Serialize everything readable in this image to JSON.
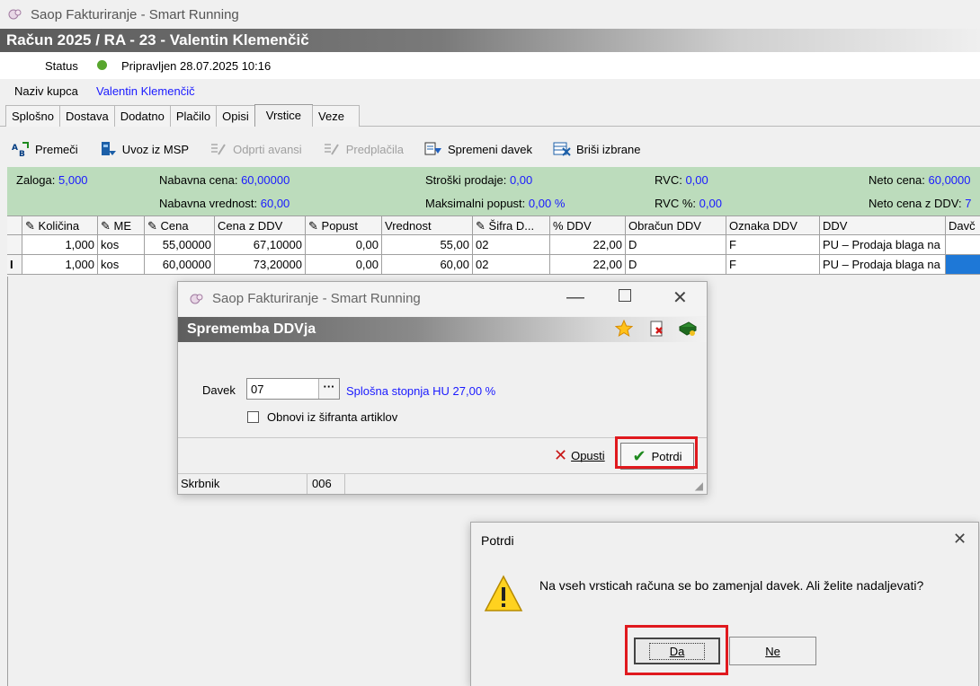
{
  "app": {
    "title": "Saop Fakturiranje - Smart Running"
  },
  "document": {
    "header": "Račun  2025 / RA - 23 - Valentin Klemenčič"
  },
  "status": {
    "label": "Status",
    "text": "Pripravljen 28.07.2025 10:16",
    "color": "#58a62e"
  },
  "customer": {
    "label": "Naziv kupca",
    "value": "Valentin Klemenčič"
  },
  "tabs": [
    {
      "label": "Splošno"
    },
    {
      "label": "Dostava"
    },
    {
      "label": "Dodatno"
    },
    {
      "label": "Plačilo"
    },
    {
      "label": "Opisi"
    },
    {
      "label": "Vrstice",
      "active": true
    },
    {
      "label": "Veze"
    }
  ],
  "toolbar": {
    "premeci": "Premeči",
    "uvoz": "Uvoz iz MSP",
    "avansi": "Odprti avansi",
    "predplacila": "Predplačila",
    "spremeni": "Spremeni davek",
    "brisi": "Briši izbrane"
  },
  "info": {
    "zaloga_label": "Zaloga:",
    "zaloga": "5,000",
    "nab_cena_label": "Nabavna cena:",
    "nab_cena": "60,00000",
    "nab_vred_label": "Nabavna vrednost:",
    "nab_vred": "60,00",
    "stroski_label": "Stroški prodaje:",
    "stroski": "0,00",
    "max_popust_label": "Maksimalni popust:",
    "max_popust": "0,00 %",
    "rvc_label": "RVC:",
    "rvc": "0,00",
    "rvc_pct_label": "RVC %:",
    "rvc_pct": "0,00",
    "neto_label": "Neto cena:",
    "neto": "60,0000",
    "neto_ddv_label": "Neto cena z DDV:",
    "neto_ddv": "7"
  },
  "grid": {
    "columns": [
      "Količina",
      "ME",
      "Cena",
      "Cena z DDV",
      "Popust",
      "Vrednost",
      "Šifra D...",
      "% DDV",
      "Obračun DDV",
      "Oznaka DDV",
      "DDV",
      "Davč"
    ],
    "rows": [
      [
        "1,000",
        "kos",
        "55,00000",
        "67,10000",
        "0,00",
        "55,00",
        "02",
        "22,00",
        "D",
        "F",
        "PU – Prodaja blaga na",
        ""
      ],
      [
        "1,000",
        "kos",
        "60,00000",
        "73,20000",
        "0,00",
        "60,00",
        "02",
        "22,00",
        "D",
        "F",
        "PU – Prodaja blaga na",
        ""
      ]
    ],
    "row_marker": "I"
  },
  "dialog_ddv": {
    "title": "Saop Fakturiranje - Smart Running",
    "caption": "Sprememba DDVja",
    "davek_label": "Davek",
    "davek_value": "07",
    "davek_desc": "Splošna stopnja HU 27,00 %",
    "checkbox_label": "Obnovi iz šifranta artiklov",
    "cancel": "Opusti",
    "confirm": "Potrdi",
    "status_user": "Skrbnik",
    "status_code": "006"
  },
  "dialog_confirm": {
    "title": "Potrdi",
    "message": "Na vseh vrsticah računa se bo zamenjal davek. Ali želite nadaljevati?",
    "yes": "Da",
    "no": "Ne"
  },
  "colors": {
    "accent_red": "#e0191e",
    "info_green": "#bcdcbc",
    "link_blue": "#1a1aff"
  }
}
